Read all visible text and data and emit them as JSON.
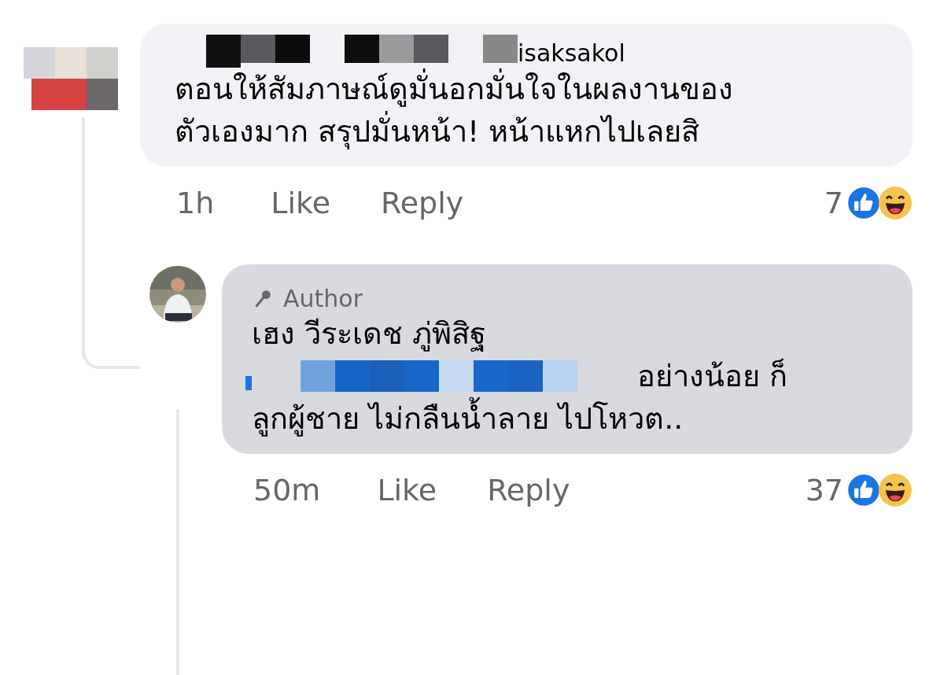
{
  "comment": {
    "name": "isaksakol",
    "lines": [
      "ตอนให้สัมภาษณ์ดูมั่นอกมั่นใจในผลงานของ",
      "ตัวเองมาก สรุปมั่นหน้า! หน้าแหกไปเลยสิ"
    ],
    "time": "1h",
    "like": "Like",
    "reply": "Reply",
    "reaction_count": "7"
  },
  "reply": {
    "badge": "Author",
    "name": "เฮง วีระเดช ภู่พิสิฐ",
    "lines": [
      "อย่างน้อย ก็",
      "ลูกผู้ชาย ไม่กลืนน้ำลาย ไปโหวต.."
    ],
    "time": "50m",
    "like": "Like",
    "reply": "Reply",
    "reaction_count": "37"
  }
}
